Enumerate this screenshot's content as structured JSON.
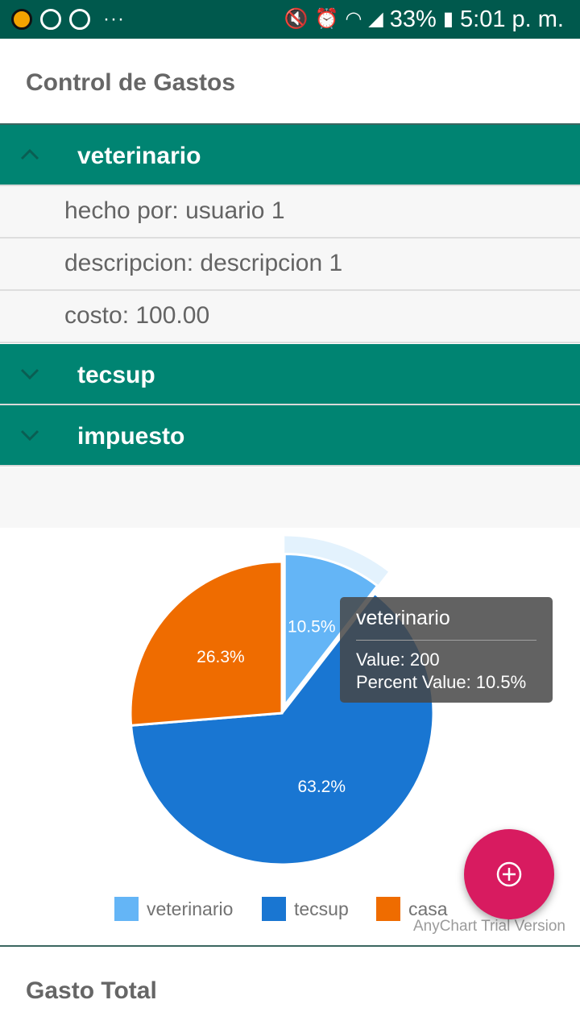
{
  "status_bar": {
    "left_icons": [
      "whatsapp-icon",
      "sync-icon",
      "messenger-icon"
    ],
    "overflow": "···",
    "right_icons": [
      "mute-icon",
      "alarm-icon",
      "wifi-icon",
      "signal-icon",
      "battery-icon"
    ],
    "battery": "33%",
    "time": "5:01 p. m."
  },
  "app": {
    "title": "Control de Gastos"
  },
  "accordion": {
    "items": [
      {
        "title": "veterinario",
        "expanded": true,
        "details": [
          "hecho por: usuario 1",
          "descripcion: descripcion 1",
          "costo: 100.00"
        ]
      },
      {
        "title": "tecsup",
        "expanded": false
      },
      {
        "title": "impuesto",
        "expanded": false
      }
    ]
  },
  "chart_data": {
    "type": "pie",
    "categories": [
      "veterinario",
      "tecsup",
      "casa"
    ],
    "percent_labels": [
      "10.5%",
      "63.2%",
      "26.3%"
    ],
    "values_percent": [
      10.5,
      63.2,
      26.3
    ],
    "colors": [
      "#64b5f6",
      "#1976d2",
      "#ef6c00"
    ],
    "hover_color": "#e3f2fd",
    "selected": "veterinario",
    "legend": [
      "veterinario",
      "tecsup",
      "casa"
    ],
    "legend_position": "bottom",
    "tooltip": {
      "title": "veterinario",
      "value_line": "Value: 200",
      "percent_line": "Percent Value: 10.5%"
    },
    "credits": "AnyChart Trial Version"
  },
  "fab": {
    "icon": "add-circle-icon",
    "color": "#d81b60"
  },
  "footer": {
    "title": "Gasto Total"
  }
}
